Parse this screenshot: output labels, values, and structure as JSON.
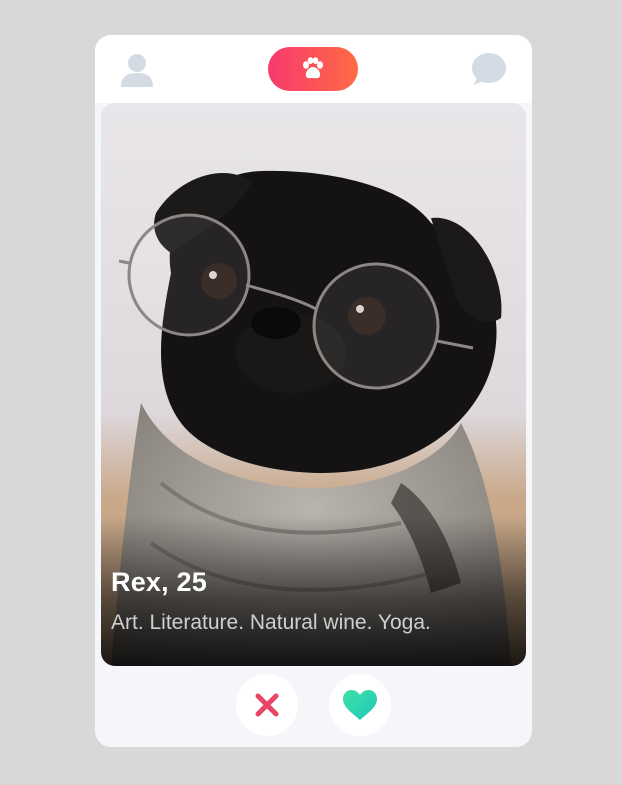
{
  "nav": {
    "left_icon": "profile-icon",
    "center_icon": "paw-icon",
    "right_icon": "chat-icon",
    "accent_gradient": [
      "#f73a6d",
      "#ff6a45"
    ],
    "inactive_icon_color": "#d5dbe5"
  },
  "profile": {
    "name_age": "Rex, 25",
    "bio": "Art. Literature. Natural wine. Yoga.",
    "photo_subject": "pug-with-glasses-photo"
  },
  "actions": {
    "dislike_icon": "close-icon",
    "dislike_color": "#e94565",
    "like_icon": "heart-icon",
    "like_color": "#2ad8b0"
  }
}
